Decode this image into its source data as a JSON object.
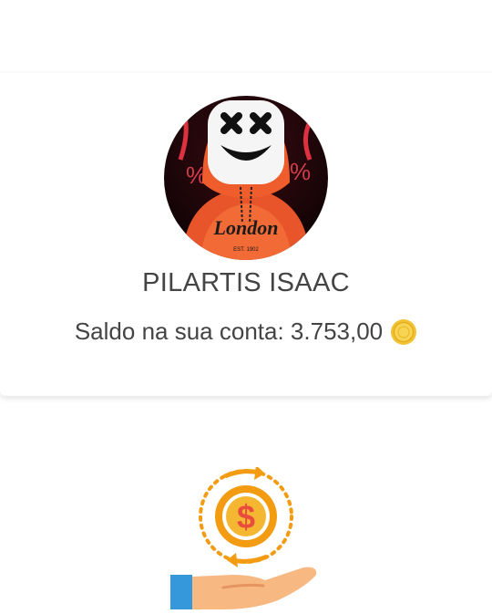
{
  "profile": {
    "name": "PILARTIS ISAAC",
    "balance_label": "Saldo na sua conta:",
    "balance_value": "3.753,00",
    "avatar_icon": "avatar-icon",
    "coin_icon": "coin-icon"
  },
  "illustration": {
    "icon": "money-hand-icon"
  },
  "colors": {
    "text": "#444444",
    "coin": "#f2c230",
    "accent_orange": "#f39c12",
    "dollar_red": "#e74c3c",
    "sleeve_blue": "#3498db",
    "hand": "#f7b882"
  }
}
